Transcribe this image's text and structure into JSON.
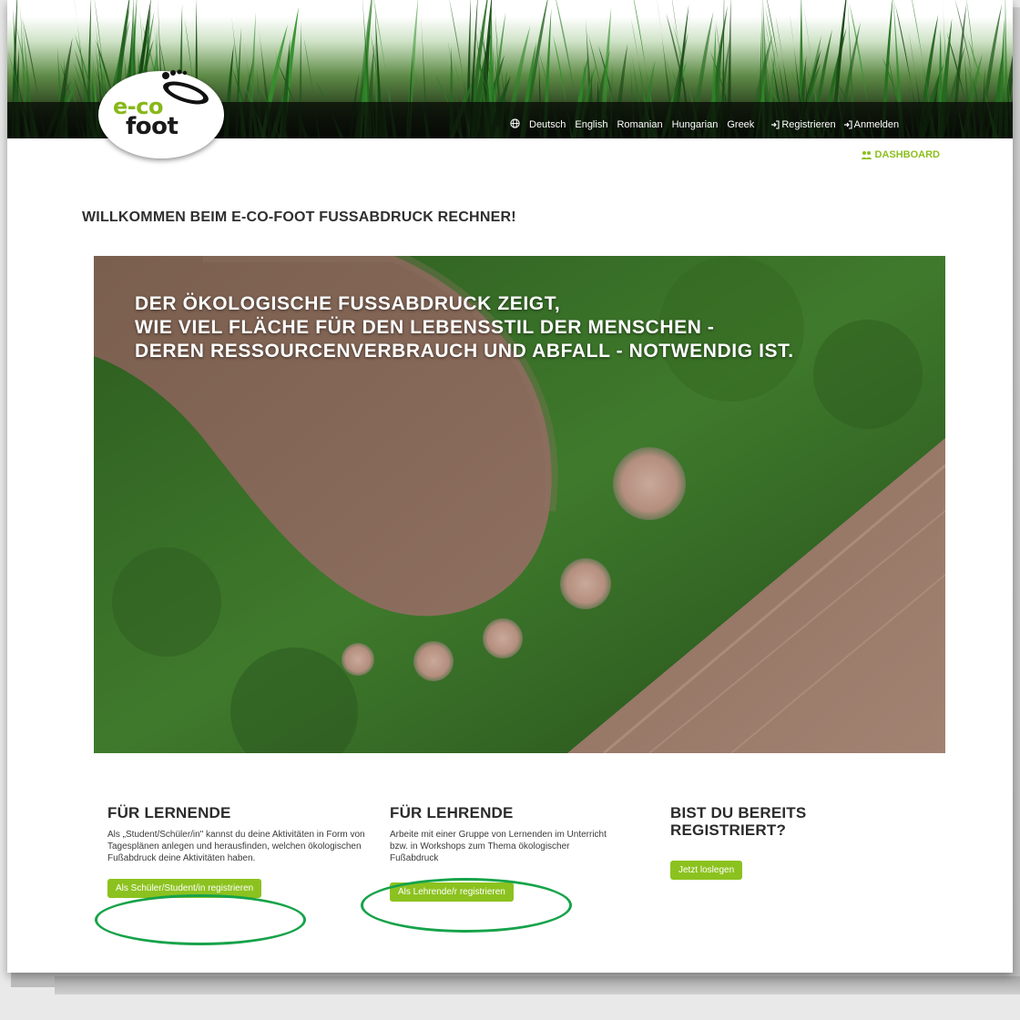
{
  "logo": {
    "line1": "e-co",
    "line2": "foot"
  },
  "nav": {
    "languages": [
      "Deutsch",
      "English",
      "Romanian",
      "Hungarian",
      "Greek"
    ],
    "register": "Registrieren",
    "login": "Anmelden"
  },
  "dashboard": "DASHBOARD",
  "welcome": "WILLKOMMEN BEIM E-CO-FOOT FUSSABDRUCK RECHNER!",
  "hero": {
    "lines": [
      "DER ÖKOLOGISCHE FUSSABDRUCK ZEIGT,",
      "WIE VIEL FLÄCHE FÜR DEN LEBENSSTIL DER MENSCHEN -",
      "DEREN RESSOURCENVERBRAUCH UND ABFALL - NOTWENDIG IST."
    ]
  },
  "columns": [
    {
      "title": "FÜR LERNENDE",
      "text": "Als „Student/Schüler/in\" kannst du deine Aktivitäten in Form von Tagesplänen anlegen und herausfinden, welchen ökologischen Fußabdruck deine Aktivitäten haben.",
      "button": "Als Schüler/Student/in registrieren"
    },
    {
      "title": "FÜR LEHRENDE",
      "text": "Arbeite mit einer Gruppe von Lernenden im Unterricht bzw. in Workshops zum Thema ökologischer Fußabdruck",
      "button": "Als Lehrende/r registrieren"
    },
    {
      "title": "BIST DU BEREITS REGISTRIERT?",
      "text": "",
      "button": "Jetzt loslegen"
    }
  ],
  "colors": {
    "accent": "#8cc21f",
    "highlight_ring": "#16a34a",
    "header_dark": "#0d120b"
  },
  "icons": [
    "globe-icon",
    "login-arrow-icon",
    "dashboard-icon",
    "footprint-icon"
  ]
}
